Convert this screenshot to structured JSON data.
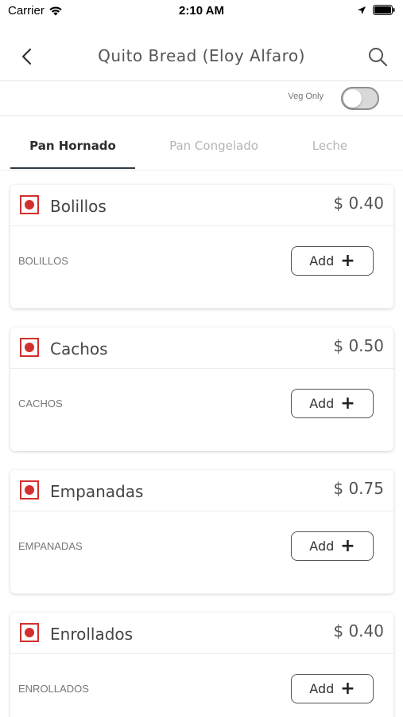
{
  "status_bar": {
    "carrier": "Carrier",
    "time": "2:10 AM"
  },
  "header": {
    "title": "Quito Bread (Eloy Alfaro)"
  },
  "filter": {
    "veg_only_label": "Veg Only",
    "veg_only_on": false
  },
  "tabs": [
    {
      "label": "Pan Hornado",
      "active": true
    },
    {
      "label": "Pan Congelado",
      "active": false
    },
    {
      "label": "Leche",
      "active": false
    }
  ],
  "items": [
    {
      "name": "Bolillos",
      "price": "$ 0.40",
      "description": "BOLILLOS",
      "add_label": "Add"
    },
    {
      "name": "Cachos",
      "price": "$ 0.50",
      "description": "CACHOS",
      "add_label": "Add"
    },
    {
      "name": "Empanadas",
      "price": "$ 0.75",
      "description": "EMPANADAS",
      "add_label": "Add"
    },
    {
      "name": "Enrollados",
      "price": "$ 0.40",
      "description": "ENROLLADOS",
      "add_label": "Add"
    }
  ],
  "colors": {
    "veg_marker": "#d32f2f",
    "tab_active_underline": "#2f3b45"
  }
}
